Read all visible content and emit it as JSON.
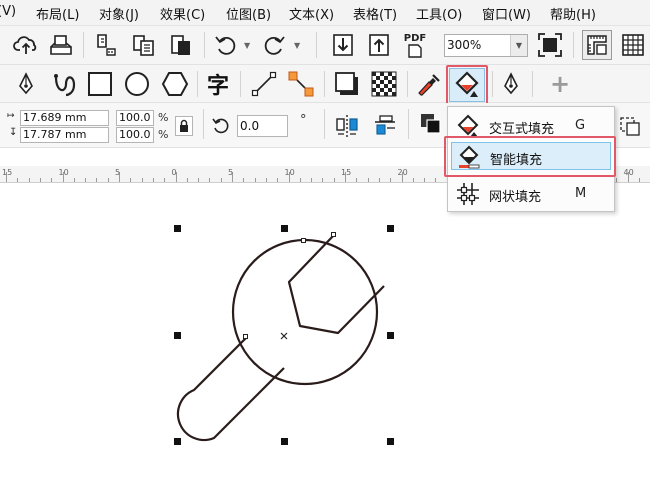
{
  "menu": {
    "items": [
      "(V)",
      "布局(L)",
      "对象(J)",
      "效果(C)",
      "位图(B)",
      "文本(X)",
      "表格(T)",
      "工具(O)",
      "窗口(W)",
      "帮助(H)"
    ]
  },
  "toolbar": {
    "pdf_label": "PDF",
    "zoom_value": "300%"
  },
  "tools": {
    "text_tool_glyph": "字",
    "add_glyph": "+"
  },
  "property_bar": {
    "width_value": "17.689 mm",
    "height_value": "17.787 mm",
    "scale_x": "100.0",
    "scale_y": "100.0",
    "percent_symbol": "%",
    "rotation_value": "0.0",
    "degree_symbol": "°"
  },
  "ruler": {
    "labels": [
      "15",
      "10",
      "5",
      "0",
      "5",
      "10",
      "15",
      "20",
      "25",
      "30",
      "35",
      "40"
    ]
  },
  "flyout": {
    "items": [
      {
        "label": "交互式填充",
        "shortcut": "G"
      },
      {
        "label": "智能填充",
        "shortcut": ""
      },
      {
        "label": "网状填充",
        "shortcut": "M"
      }
    ]
  },
  "colors": {
    "highlight": "#e15868",
    "selected_bg": "#dbeefa",
    "selected_border": "#7fc2ea",
    "drawing_stroke": "#2a1c1a"
  },
  "icons": [
    "cloud-icon",
    "print-icon",
    "import-icon",
    "export-icon",
    "undo-icon",
    "redo-icon",
    "fullscreen-icon",
    "ruler-settings-icon",
    "grid-icon",
    "pen-nib-icon",
    "curve-icon",
    "rectangle-icon",
    "ellipse-icon",
    "polygon-icon",
    "line-icon",
    "connector-icon",
    "shadow-icon",
    "transparency-icon",
    "eyedropper-icon",
    "fill-icon",
    "outline-pen-icon",
    "lock-ratio-icon",
    "rotate-icon",
    "mirror-icon",
    "align-icon",
    "order-icon"
  ]
}
